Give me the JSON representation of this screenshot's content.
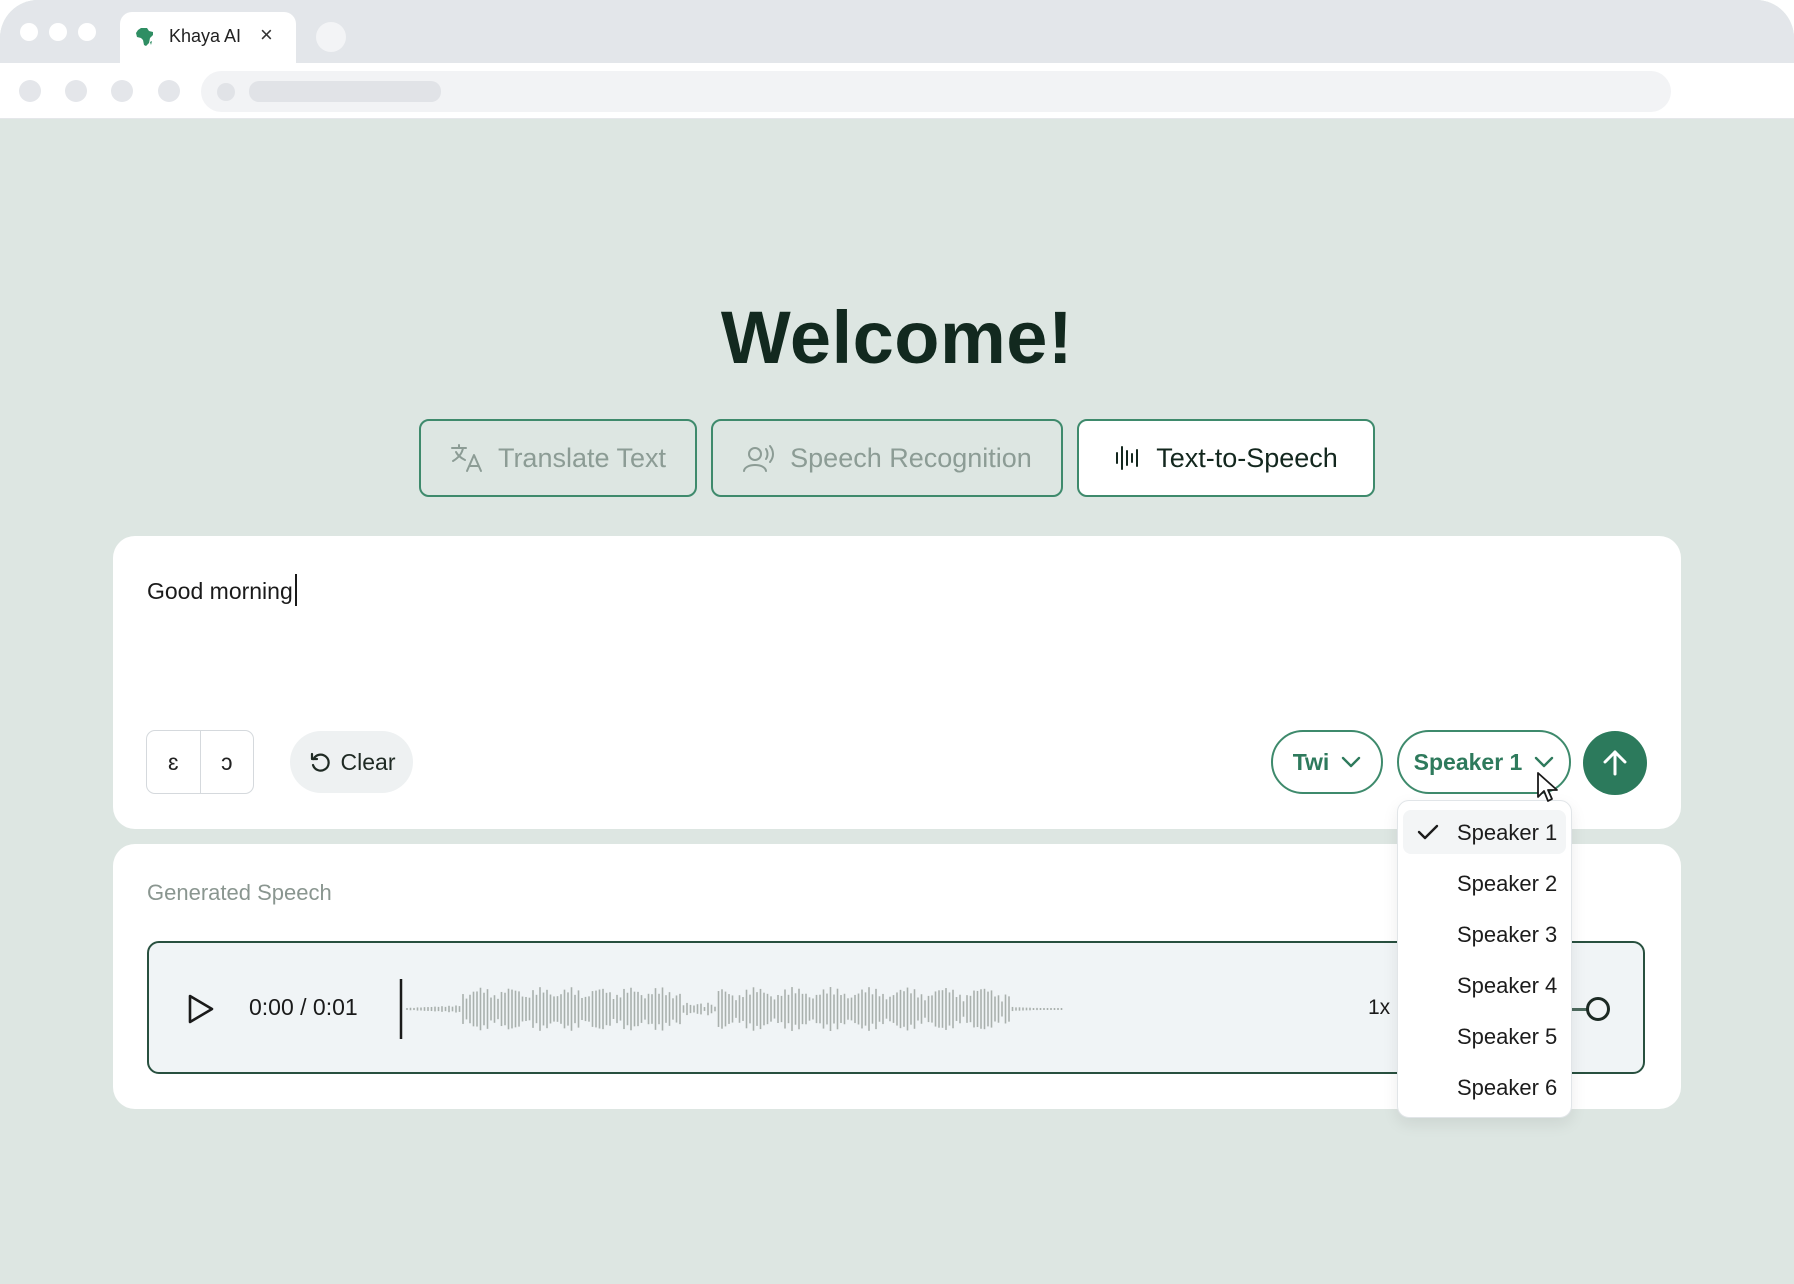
{
  "browser": {
    "tab_title": "Khaya AI",
    "tab_close": "×"
  },
  "page": {
    "heading": "Welcome!",
    "modes": [
      {
        "label": "Translate Text",
        "icon": "translate-icon",
        "active": false
      },
      {
        "label": "Speech Recognition",
        "icon": "speaker-voice-icon",
        "active": false
      },
      {
        "label": "Text-to-Speech",
        "icon": "audio-wave-icon",
        "active": true
      }
    ]
  },
  "input": {
    "text": "Good morning",
    "special_chars": [
      "ɛ",
      "ɔ"
    ],
    "clear_label": "Clear",
    "language": "Twi",
    "speaker": "Speaker 1"
  },
  "output": {
    "label": "Generated Speech",
    "time": "0:00 / 0:01",
    "speed": "1x"
  },
  "speaker_menu": {
    "selected": "Speaker 1",
    "options": [
      "Speaker 1",
      "Speaker 2",
      "Speaker 3",
      "Speaker 4",
      "Speaker 5",
      "Speaker 6"
    ]
  },
  "colors": {
    "page_bg": "#dde6e2",
    "accent": "#2c7a5c",
    "border_green": "#3e8a6c",
    "heading": "#12291f"
  }
}
